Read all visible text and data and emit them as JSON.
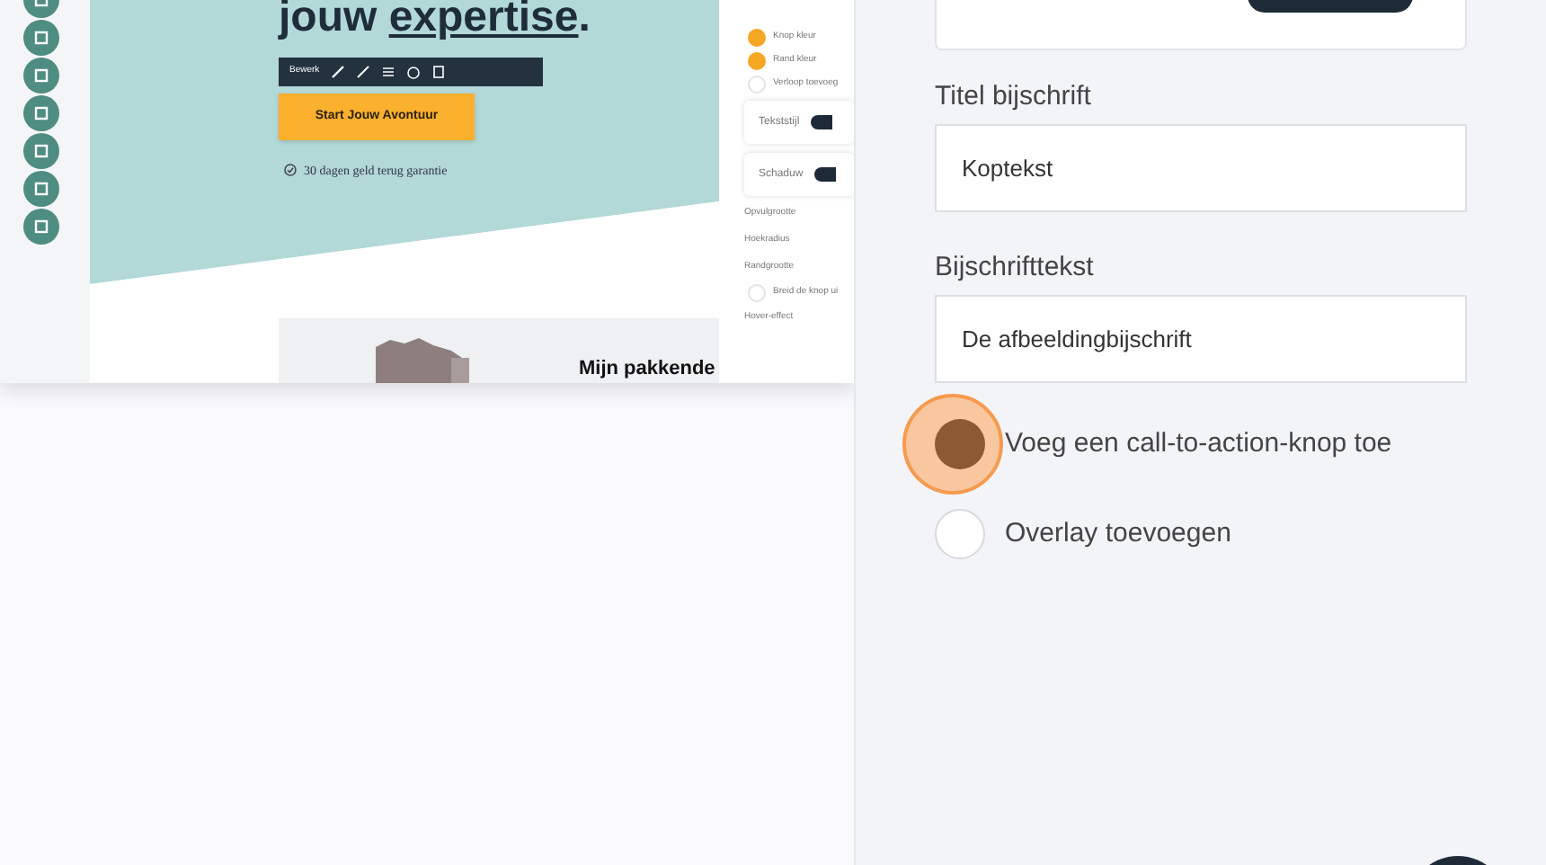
{
  "preview": {
    "heading_start": "jouw ",
    "heading_underlined": "expertise",
    "heading_end": ".",
    "toolbar_label": "Bewerk",
    "cta_button": "Start Jouw Avontuur",
    "guarantee": "30 dagen geld terug garantie",
    "section_heading": "Mijn pakkende",
    "settings": [
      {
        "kind": "swatch",
        "label": "Knop kleur",
        "color": "#f5a623"
      },
      {
        "kind": "swatch",
        "label": "Rand kleur",
        "color": "#f5a623"
      },
      {
        "kind": "toggle",
        "label": "Verloop toevoeg",
        "checked": false
      },
      {
        "kind": "card",
        "label": "Tekststijl",
        "on": true
      },
      {
        "kind": "card",
        "label": "Schaduw",
        "on": true
      },
      {
        "kind": "row",
        "label": "Opvulgrootte"
      },
      {
        "kind": "row",
        "label": "Hoekradius"
      },
      {
        "kind": "row",
        "label": "Randgrootte"
      },
      {
        "kind": "toggle",
        "label": "Breid de knop ui",
        "checked": false
      },
      {
        "kind": "row",
        "label": "Hover-effect"
      }
    ]
  },
  "fields": [
    {
      "label": "Titel bijschrift",
      "value": "Koptekst"
    },
    {
      "label": "Bijschrifttekst",
      "value": "De afbeeldingbijschrift"
    }
  ],
  "options": [
    {
      "label": "Voeg een call-to-action-knop toe",
      "checked": true,
      "focused": true
    },
    {
      "label": "Overlay toevoegen",
      "checked": false,
      "focused": false
    }
  ]
}
